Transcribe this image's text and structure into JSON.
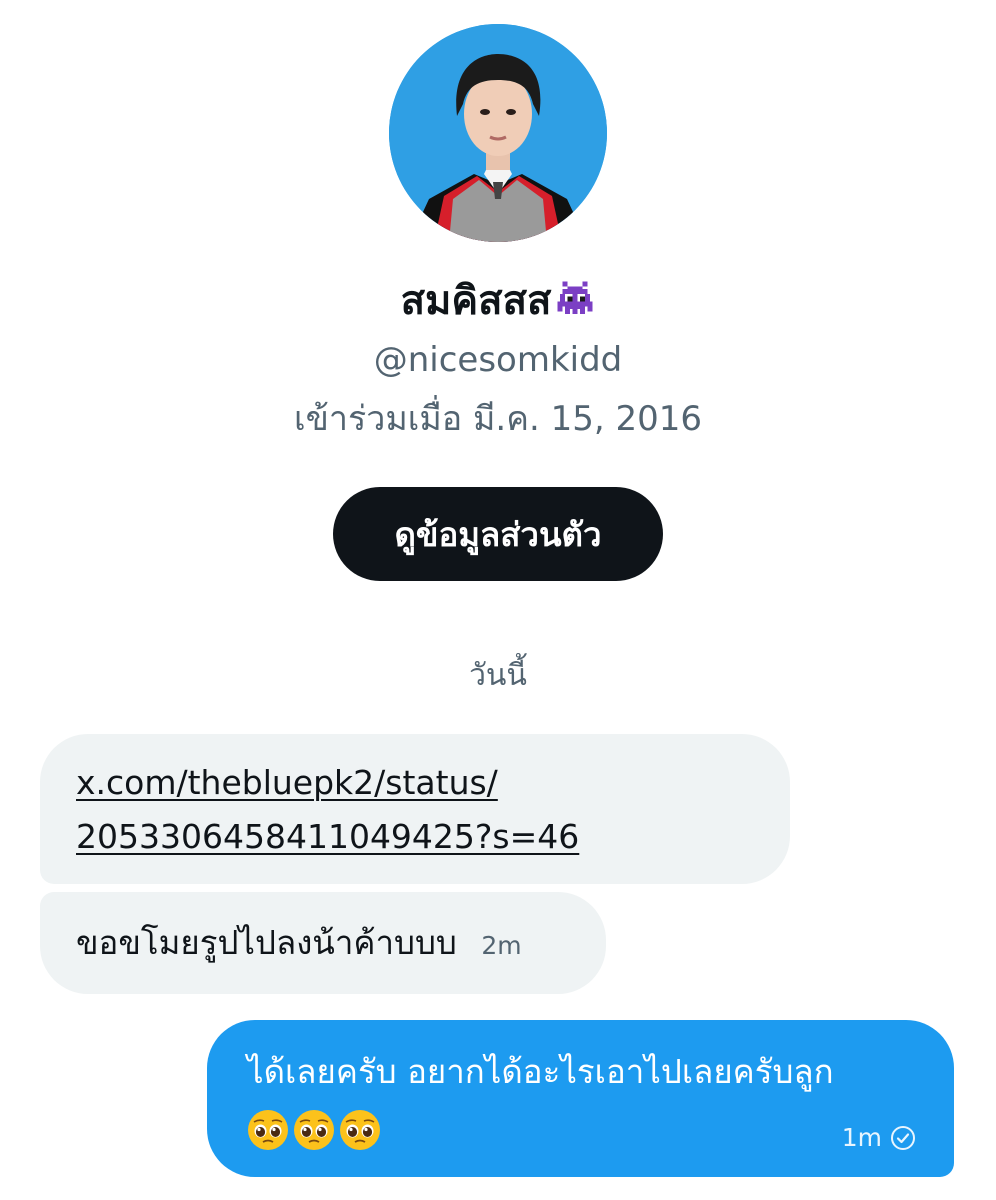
{
  "profile": {
    "display_name": "สมคิสสส",
    "name_emoji": "alien-monster-icon",
    "handle": "@nicesomkidd",
    "joined": "เข้าร่วมเมื่อ มี.ค. 15, 2016",
    "view_profile_label": "ดูข้อมูลส่วนตัว"
  },
  "conversation": {
    "date_divider": "วันนี้",
    "messages": [
      {
        "direction": "incoming",
        "link_line1": "x.com/thebluepk2/status/",
        "link_line2": "2053306458411049425?s=46"
      },
      {
        "direction": "incoming",
        "text": "ขอขโมยรูปไปลงน้าค้าบบบ",
        "time": "2m"
      },
      {
        "direction": "outgoing",
        "text": "ได้เลยครับ อยากได้อะไรเอาไปเลยครับลูก",
        "emojis": [
          "pleading-face-icon",
          "pleading-face-icon",
          "pleading-face-icon"
        ],
        "time": "1m",
        "status_icon": "read-check-icon"
      }
    ]
  },
  "colors": {
    "bubble_incoming": "#eff3f4",
    "bubble_outgoing": "#1d9bf0",
    "secondary_text": "#536471",
    "button_bg": "#0f1419"
  }
}
